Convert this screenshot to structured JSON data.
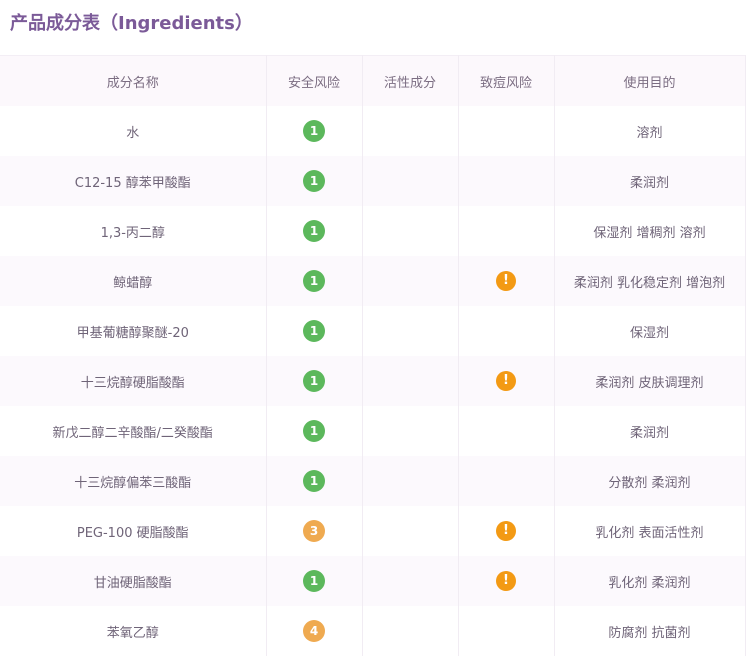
{
  "title": "产品成分表（Ingredients）",
  "headers": [
    "成分名称",
    "安全风险",
    "活性成分",
    "致痘风险",
    "使用目的"
  ],
  "colors": {
    "risk_low": "#5cb85c",
    "risk_mid": "#efaa50",
    "acne_warn": "#f39a14"
  },
  "rows": [
    {
      "name": "水",
      "risk": "1",
      "acne": false,
      "purpose": "溶剂"
    },
    {
      "name": "C12-15 醇苯甲酸酯",
      "risk": "1",
      "acne": false,
      "purpose": "柔润剂"
    },
    {
      "name": "1,3-丙二醇",
      "risk": "1",
      "acne": false,
      "purpose": "保湿剂 增稠剂 溶剂"
    },
    {
      "name": "鲸蜡醇",
      "risk": "1",
      "acne": true,
      "purpose": "柔润剂 乳化稳定剂 增泡剂"
    },
    {
      "name": "甲基葡糖醇聚醚-20",
      "risk": "1",
      "acne": false,
      "purpose": "保湿剂"
    },
    {
      "name": "十三烷醇硬脂酸酯",
      "risk": "1",
      "acne": true,
      "purpose": "柔润剂 皮肤调理剂"
    },
    {
      "name": "新戊二醇二辛酸酯/二癸酸酯",
      "risk": "1",
      "acne": false,
      "purpose": "柔润剂"
    },
    {
      "name": "十三烷醇偏苯三酸酯",
      "risk": "1",
      "acne": false,
      "purpose": "分散剂 柔润剂"
    },
    {
      "name": "PEG-100 硬脂酸酯",
      "risk": "3",
      "acne": true,
      "purpose": "乳化剂 表面活性剂"
    },
    {
      "name": "甘油硬脂酸酯",
      "risk": "1",
      "acne": true,
      "purpose": "乳化剂 柔润剂"
    },
    {
      "name": "苯氧乙醇",
      "risk": "4",
      "acne": false,
      "purpose": "防腐剂 抗菌剂"
    }
  ]
}
